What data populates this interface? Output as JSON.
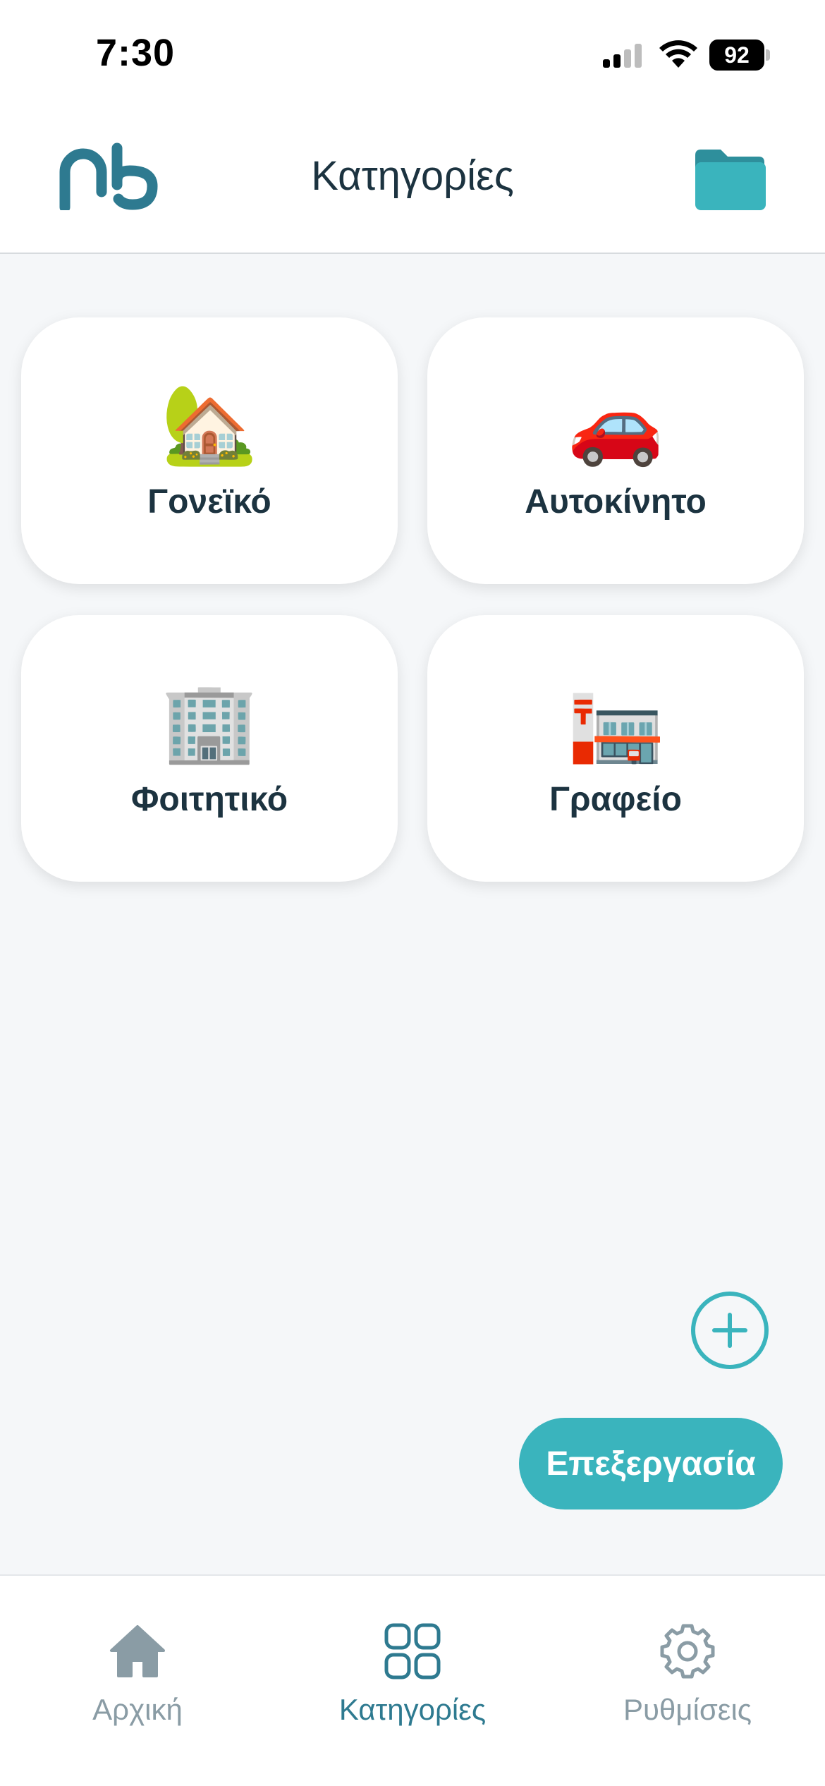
{
  "status_bar": {
    "time": "7:30",
    "battery": "92"
  },
  "header": {
    "title": "Κατηγορίες",
    "logo_icon": "logo-icon",
    "folder_icon": "folder-icon"
  },
  "categories": [
    {
      "emoji": "🏡",
      "label": "Γονεϊκό"
    },
    {
      "emoji": "🚗",
      "label": "Αυτοκίνητο"
    },
    {
      "emoji": "🏢",
      "label": "Φοιτητικό"
    },
    {
      "emoji": "🏣",
      "label": "Γραφείο"
    }
  ],
  "actions": {
    "add_icon": "plus-circle-icon",
    "edit_label": "Επεξεργασία"
  },
  "tab_bar": {
    "items": [
      {
        "label": "Αρχική",
        "icon": "home-icon",
        "active": false
      },
      {
        "label": "Κατηγορίες",
        "icon": "grid-icon",
        "active": true
      },
      {
        "label": "Ρυθμίσεις",
        "icon": "gear-icon",
        "active": false
      }
    ]
  },
  "colors": {
    "accent": "#3ab4bd",
    "text": "#1c3340",
    "active_tab": "#2e7a90",
    "inactive_tab": "#8a9ca5",
    "background": "#f5f7f9"
  }
}
